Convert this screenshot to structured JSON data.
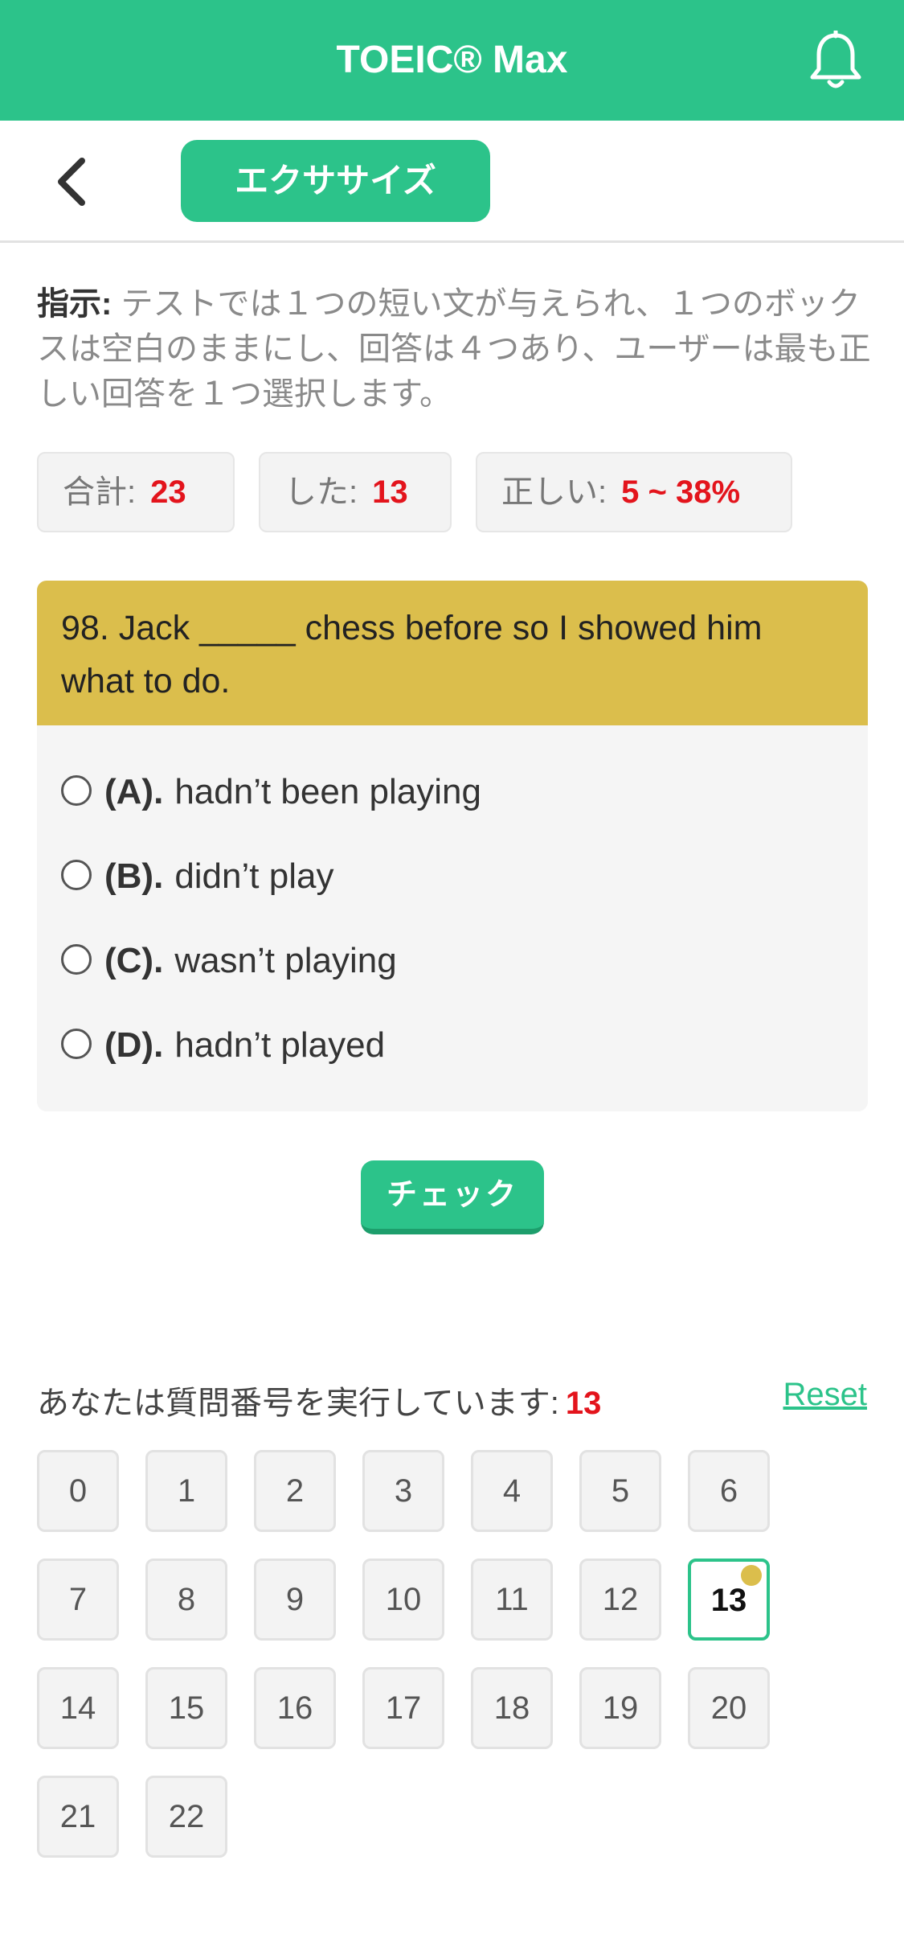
{
  "header": {
    "title": "TOEIC® Max"
  },
  "subnav": {
    "pill_label": "エクササイズ"
  },
  "instructions": {
    "label": "指示:",
    "text": " テストでは１つの短い文が与えられ、１つのボックスは空白のままにし、回答は４つあり、ユーザーは最も正しい回答を１つ選択します。"
  },
  "stats": {
    "total_label": "合計:",
    "total_value": "23",
    "done_label": "した:",
    "done_value": "13",
    "correct_label": "正しい:",
    "correct_value": "5 ~ 38%"
  },
  "question": {
    "text": "98. Jack _____ chess before so I showed him what to do.",
    "options": [
      {
        "letter": "(A).",
        "text": "hadn’t been playing"
      },
      {
        "letter": "(B).",
        "text": "didn’t play"
      },
      {
        "letter": "(C).",
        "text": "wasn’t playing"
      },
      {
        "letter": "(D).",
        "text": "hadn’t played"
      }
    ]
  },
  "check_label": "チェック",
  "progress": {
    "label": "あなたは質問番号を実行しています:",
    "current": "13",
    "reset_label": "Reset"
  },
  "grid": [
    "0",
    "1",
    "2",
    "3",
    "4",
    "5",
    "6",
    "7",
    "8",
    "9",
    "10",
    "11",
    "12",
    "13",
    "14",
    "15",
    "16",
    "17",
    "18",
    "19",
    "20",
    "21",
    "22"
  ],
  "active_index": 13,
  "colors": {
    "brand": "#2cc38a",
    "question_bg": "#dbbe4c",
    "accent_red": "#e3141c"
  }
}
